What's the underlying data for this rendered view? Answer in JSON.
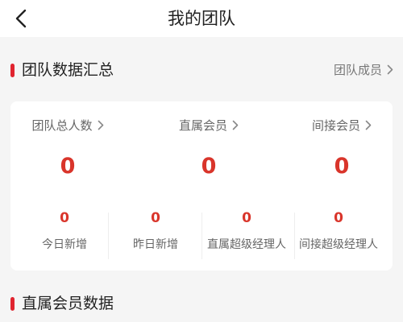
{
  "header": {
    "title": "我的团队"
  },
  "summary": {
    "title": "团队数据汇总",
    "members_link": "团队成员"
  },
  "top_stats": [
    {
      "label": "团队总人数",
      "value": "0"
    },
    {
      "label": "直属会员",
      "value": "0"
    },
    {
      "label": "间接会员",
      "value": "0"
    }
  ],
  "bottom_stats": [
    {
      "label": "今日新增",
      "value": "0"
    },
    {
      "label": "昨日新增",
      "value": "0"
    },
    {
      "label": "直属超级经理人",
      "value": "0"
    },
    {
      "label": "间接超级经理人",
      "value": "0"
    }
  ],
  "direct_section": {
    "title": "直属会员数据"
  },
  "colors": {
    "accent": "#e0242f",
    "value_red": "#d9352b",
    "text_dark": "#222222",
    "text_gray": "#666666",
    "background": "#f5f5f5",
    "card": "#ffffff"
  },
  "icons": {
    "back": "chevron-left-icon",
    "link_arrow": "chevron-right-icon"
  }
}
